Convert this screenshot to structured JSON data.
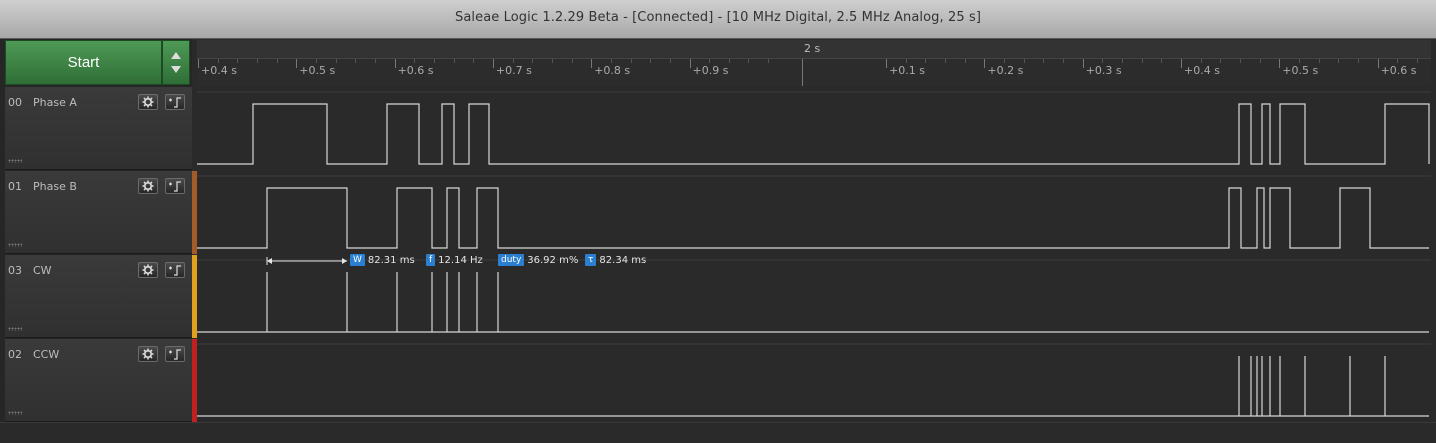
{
  "window": {
    "title": "Saleae Logic 1.2.29 Beta - [Connected] - [10 MHz Digital, 2.5 MHz Analog, 25 s]"
  },
  "controls": {
    "start_label": "Start"
  },
  "timeline": {
    "main_label": "2 s",
    "ticks": [
      {
        "label": "+0.4 s",
        "pos": 0
      },
      {
        "label": "+0.5 s",
        "pos": 1
      },
      {
        "label": "+0.6 s",
        "pos": 2
      },
      {
        "label": "+0.7 s",
        "pos": 3
      },
      {
        "label": "+0.8 s",
        "pos": 4
      },
      {
        "label": "+0.9 s",
        "pos": 5
      },
      {
        "label": "+0.1 s",
        "pos": 7
      },
      {
        "label": "+0.2 s",
        "pos": 8
      },
      {
        "label": "+0.3 s",
        "pos": 9
      },
      {
        "label": "+0.4 s",
        "pos": 10
      },
      {
        "label": "+0.5 s",
        "pos": 11
      },
      {
        "label": "+0.6 s",
        "pos": 12
      }
    ]
  },
  "channels": [
    {
      "num": "00",
      "name": "Phase A",
      "color": "#2a2a2a"
    },
    {
      "num": "01",
      "name": "Phase B",
      "color": "#a55a2a"
    },
    {
      "num": "03",
      "name": "CW",
      "color": "#e0a020"
    },
    {
      "num": "02",
      "name": "CCW",
      "color": "#c02020"
    }
  ],
  "measurements": {
    "width": {
      "tag": "W",
      "value": "82.31 ms"
    },
    "frequency": {
      "tag": "f",
      "value": "12.14 Hz"
    },
    "duty": {
      "tag": "duty",
      "value": "36.92 m%"
    },
    "period": {
      "tag": "τ",
      "value": "82.34 ms"
    }
  },
  "icons": {
    "gear": "gear-icon",
    "trigger": "trigger-icon",
    "up": "chevron-up-icon",
    "down": "chevron-down-icon"
  }
}
